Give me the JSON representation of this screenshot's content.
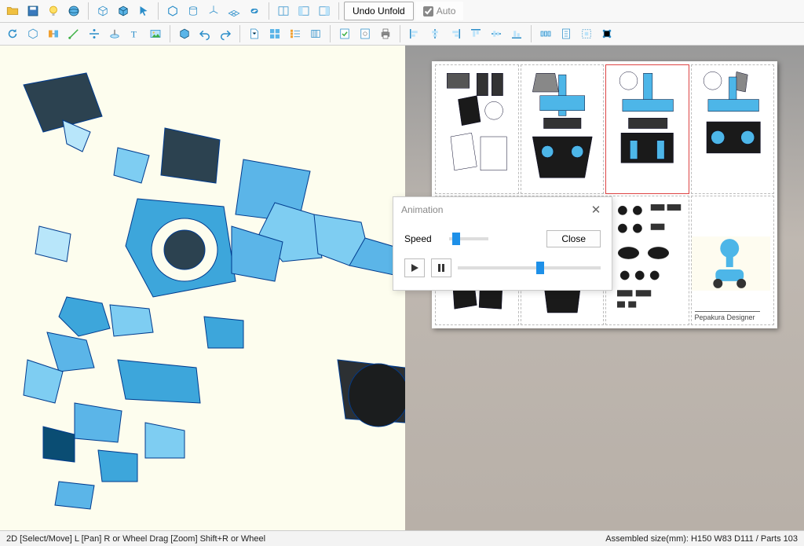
{
  "toolbar": {
    "undo_unfold_label": "Undo Unfold",
    "auto_label": "Auto",
    "auto_checked": true
  },
  "animation_dialog": {
    "title": "Animation",
    "speed_label": "Speed",
    "close_button": "Close",
    "speed_value_pct": 8,
    "progress_value_pct": 55
  },
  "view2d": {
    "designer_label": "Pepakura Designer",
    "selected_sheet_index": 2
  },
  "statusbar": {
    "left": "2D [Select/Move] L [Pan] R or Wheel Drag [Zoom] Shift+R or Wheel",
    "right": "Assembled size(mm): H150 W83 D111 / Parts 103"
  },
  "colors": {
    "accent": "#1e90e8",
    "poly_light": "#7ecdf2",
    "poly_mid": "#3da6db",
    "poly_dark": "#0a4d73"
  }
}
